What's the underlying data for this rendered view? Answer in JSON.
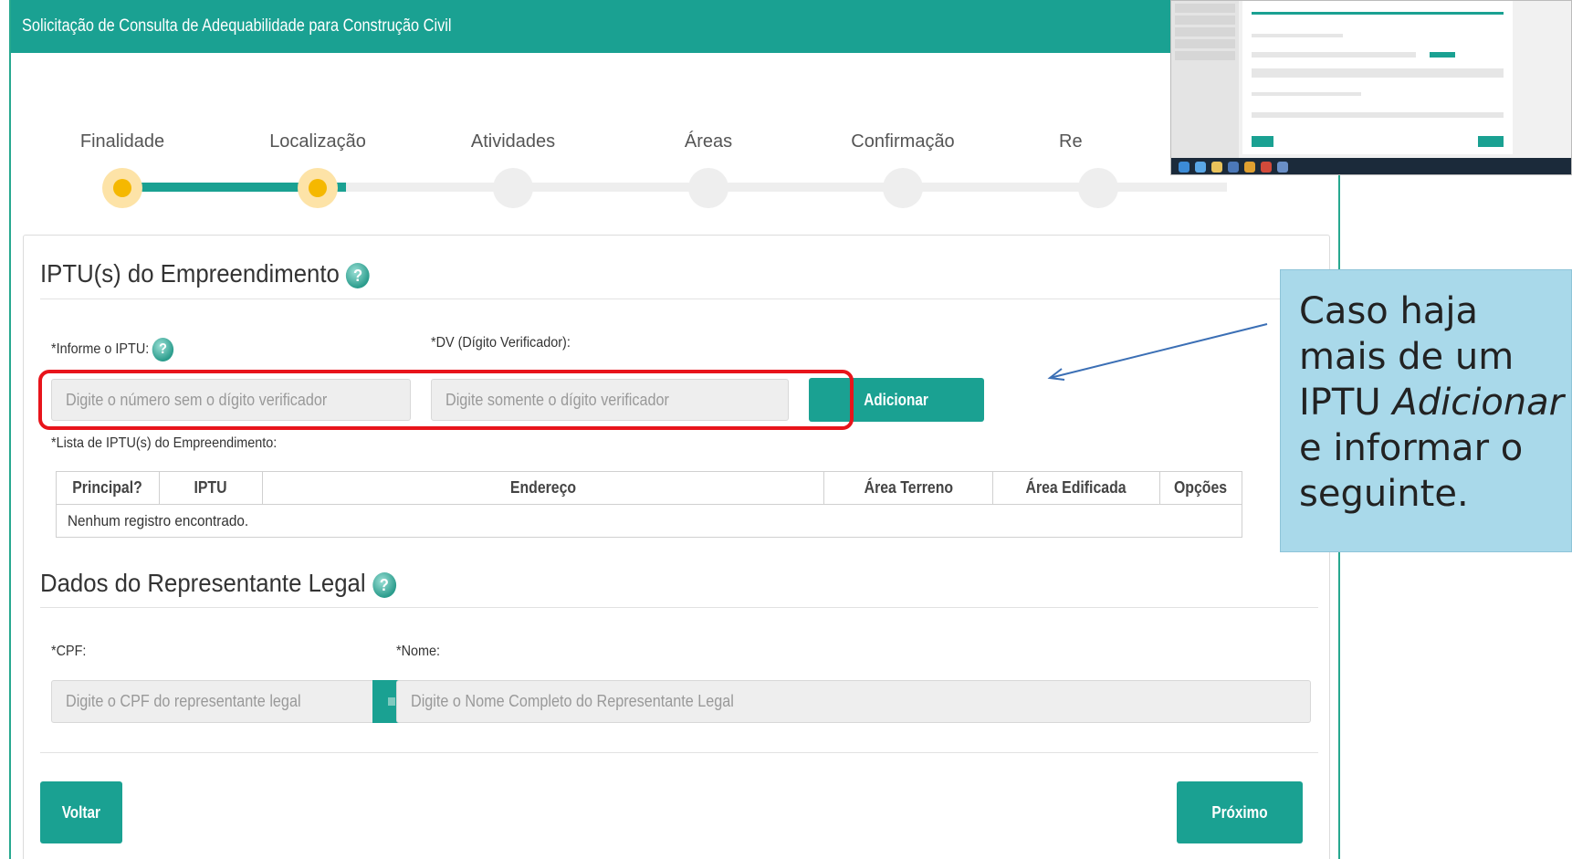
{
  "header": {
    "title": "Solicitação de Consulta de Adequabilidade para Construção Civil"
  },
  "stepper": {
    "steps": [
      {
        "label": "Finalidade",
        "state": "done"
      },
      {
        "label": "Localização",
        "state": "done"
      },
      {
        "label": "Atividades",
        "state": "pending"
      },
      {
        "label": "Áreas",
        "state": "pending"
      },
      {
        "label": "Confirmação",
        "state": "pending"
      },
      {
        "label": "Re",
        "state": "pending"
      }
    ],
    "accent_color": "#1aa192",
    "done_color": "#f5b800"
  },
  "iptu_section": {
    "title": "IPTU(s) do Empreendimento",
    "iptu_label": "*Informe o IPTU:",
    "iptu_placeholder": "Digite o número sem o dígito verificador",
    "dv_label": "*DV (Dígito Verificador):",
    "dv_placeholder": "Digite somente o dígito verificador",
    "add_button": "Adicionar",
    "list_label": "*Lista de IPTU(s) do Empreendimento:",
    "table": {
      "columns": [
        "Principal?",
        "IPTU",
        "Endereço",
        "Área Terreno",
        "Área Edificada",
        "Opções"
      ],
      "empty_message": "Nenhum registro encontrado."
    }
  },
  "legal_section": {
    "title": "Dados do Representante Legal",
    "cpf_label": "*CPF:",
    "cpf_placeholder": "Digite o CPF do representante legal",
    "name_label": "*Nome:",
    "name_placeholder": "Digite o Nome Completo do Representante Legal"
  },
  "footer": {
    "back_button": "Voltar",
    "next_button": "Próximo"
  },
  "callout": {
    "line1": "Caso haja",
    "line2": "mais de um",
    "line3_prefix": "IPTU ",
    "line3_italic": "Adicionar",
    "line4": "e informar o",
    "line5": "seguinte."
  },
  "colors": {
    "highlight": "#e8141b",
    "callout_bg": "#a9d9ea"
  },
  "icons": [
    "help-icon",
    "search-icon"
  ]
}
